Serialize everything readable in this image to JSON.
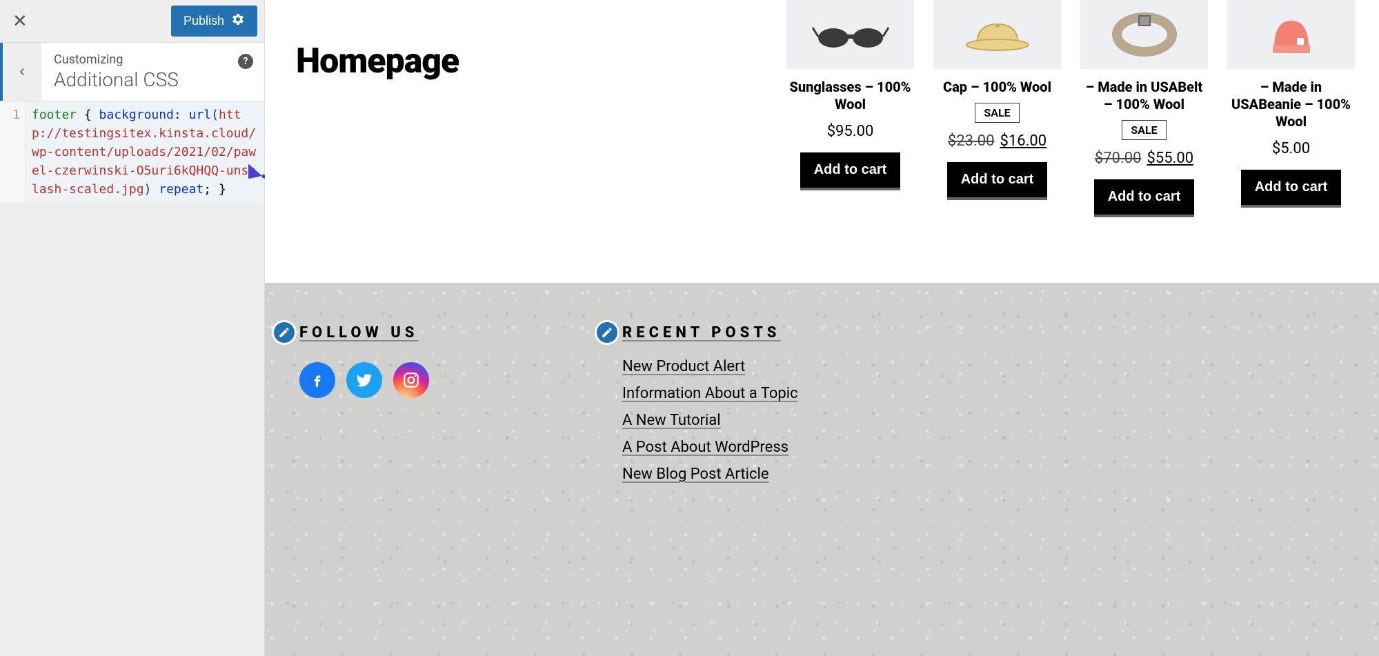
{
  "customizer": {
    "publish_label": "Publish",
    "customizing_label": "Customizing",
    "panel_title": "Additional CSS",
    "line_number": "1",
    "css_selector": "footer",
    "css_open": " { ",
    "css_property": "background",
    "css_colon": ": ",
    "css_url_func": "url(",
    "css_url": "http://testingsitex.kinsta.cloud/wp-content/uploads/2021/02/pawel-czerwinski-O5uri6kQHQQ-unsplash-scaled.jpg",
    "css_url_close": ")",
    "css_repeat": " repeat",
    "css_close": "; }"
  },
  "preview": {
    "page_title": "Homepage",
    "products": [
      {
        "name": "Sunglasses – 100% Wool",
        "sale": false,
        "price_old": "",
        "price": "$95.00",
        "cart": "Add to cart"
      },
      {
        "name": "Cap – 100% Wool",
        "sale": true,
        "sale_label": "SALE",
        "price_old": "$23.00",
        "price": "$16.00",
        "cart": "Add to cart"
      },
      {
        "name": "– Made in USABelt – 100% Wool",
        "sale": true,
        "sale_label": "SALE",
        "price_old": "$70.00",
        "price": "$55.00",
        "cart": "Add to cart"
      },
      {
        "name": "– Made in USABeanie – 100% Wool",
        "sale": false,
        "price_old": "",
        "price": "$5.00",
        "cart": "Add to cart"
      }
    ],
    "footer": {
      "follow_heading": "FOLLOW US",
      "recent_heading": "RECENT POSTS",
      "posts": [
        "New Product Alert",
        "Information About a Topic",
        "A New Tutorial",
        "A Post About WordPress",
        "New Blog Post Article"
      ]
    }
  }
}
